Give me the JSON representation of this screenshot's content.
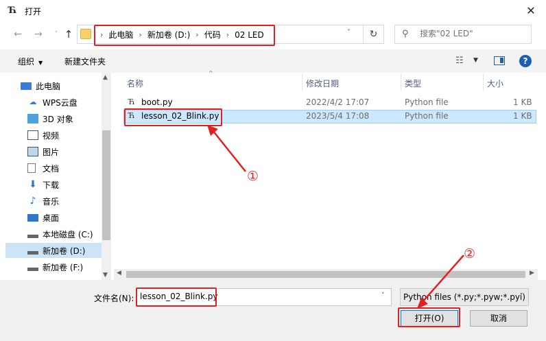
{
  "window": {
    "title": "打开",
    "close_glyph": "✕"
  },
  "address": {
    "crumbs": [
      "此电脑",
      "新加卷 (D:)",
      "代码",
      "02 LED"
    ],
    "separator": "›"
  },
  "search": {
    "placeholder": "搜索\"02 LED\""
  },
  "toolbar": {
    "organize_label": "组织",
    "new_folder_label": "新建文件夹"
  },
  "nav": {
    "items": [
      {
        "label": "此电脑",
        "icon": "computer-icon"
      },
      {
        "label": "WPS云盘",
        "icon": "cloud-icon"
      },
      {
        "label": "3D 对象",
        "icon": "3d-objects-icon"
      },
      {
        "label": "视频",
        "icon": "video-icon"
      },
      {
        "label": "图片",
        "icon": "pictures-icon"
      },
      {
        "label": "文档",
        "icon": "documents-icon"
      },
      {
        "label": "下载",
        "icon": "download-icon"
      },
      {
        "label": "音乐",
        "icon": "music-icon"
      },
      {
        "label": "桌面",
        "icon": "desktop-icon"
      },
      {
        "label": "本地磁盘 (C:)",
        "icon": "drive-icon"
      },
      {
        "label": "新加卷 (D:)",
        "icon": "drive-icon"
      },
      {
        "label": "新加卷 (F:)",
        "icon": "drive-icon"
      }
    ],
    "selected": "新加卷 (D:)"
  },
  "columns": {
    "name": "名称",
    "modified": "修改日期",
    "type": "类型",
    "size": "大小"
  },
  "files": [
    {
      "name": "boot.py",
      "modified": "2022/4/2 17:07",
      "type": "Python file",
      "size": "1 KB"
    },
    {
      "name": "lesson_02_Blink.py",
      "modified": "2023/5/4 17:08",
      "type": "Python file",
      "size": "1 KB"
    }
  ],
  "footer": {
    "filename_label": "文件名(N):",
    "filename_value": "lesson_02_Blink.py",
    "filetype_value": "Python files (*.py;*.pyw;*.pyi)",
    "open_label": "打开(O)",
    "cancel_label": "取消"
  },
  "annotations": {
    "marker1": "①",
    "marker2": "②",
    "color": "#e32020"
  },
  "colors": {
    "selection": "#cce8ff",
    "accent": "#0078d7"
  }
}
